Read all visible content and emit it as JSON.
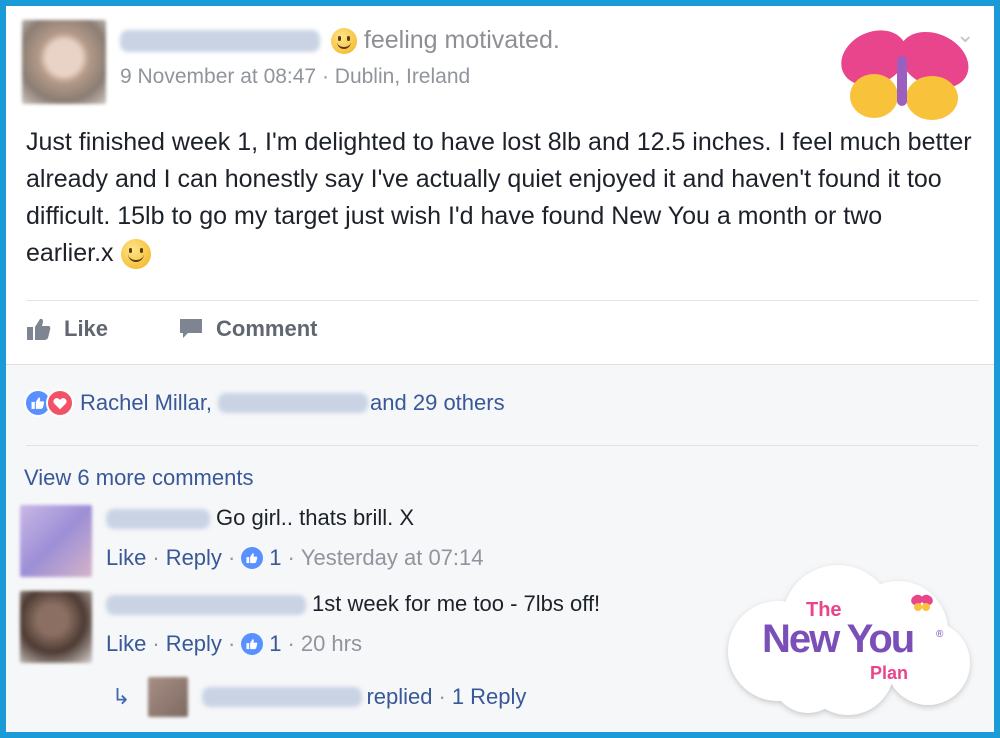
{
  "post": {
    "feeling": "feeling motivated.",
    "date_location": "9 November at 08:47 · Dublin, Ireland",
    "text": "Just finished week 1, I'm delighted to have lost 8lb and 12.5 inches. I feel much better already and I can honestly say I've actually quiet enjoyed it and haven't found it too difficult. 15lb to go my target just wish I'd have found New You a month or two earlier.x"
  },
  "actions": {
    "like": "Like",
    "comment": "Comment"
  },
  "reactions": {
    "first_name": "Rachel Millar,",
    "others": "and 29 others"
  },
  "comments": {
    "view_more": "View 6 more comments",
    "items": [
      {
        "text": "Go girl.. thats brill. X",
        "like": "Like",
        "reply": "Reply",
        "count": "1",
        "time": "Yesterday at 07:14"
      },
      {
        "text": "1st week for me too - 7lbs off!",
        "like": "Like",
        "reply": "Reply",
        "count": "1",
        "time": "20 hrs"
      }
    ],
    "reply_summary": {
      "replied": "replied",
      "count": "1 Reply"
    }
  },
  "logo": {
    "line1": "The",
    "line2": "New You",
    "line3": "Plan"
  },
  "colors": {
    "frame": "#1a9ad6",
    "link": "#385898",
    "like_blue": "#5890ff",
    "love_red": "#f25268"
  }
}
